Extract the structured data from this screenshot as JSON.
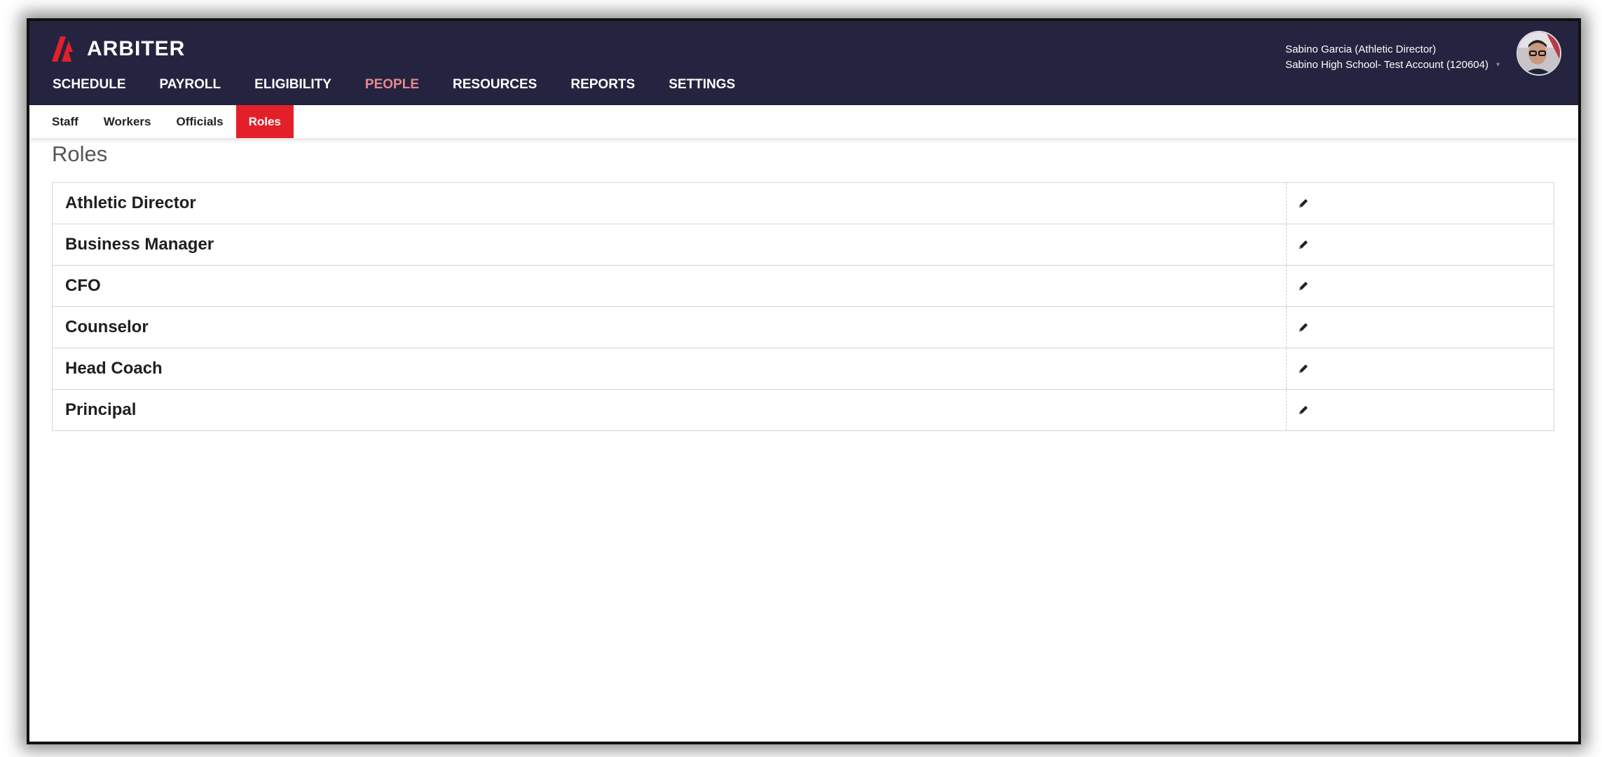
{
  "app": {
    "brand": "ARBITER"
  },
  "nav": {
    "items": [
      {
        "label": "SCHEDULE"
      },
      {
        "label": "PAYROLL"
      },
      {
        "label": "ELIGIBILITY"
      },
      {
        "label": "PEOPLE",
        "active": true
      },
      {
        "label": "RESOURCES"
      },
      {
        "label": "REPORTS"
      },
      {
        "label": "SETTINGS"
      }
    ]
  },
  "user": {
    "name": "Sabino Garcia (Athletic Director)",
    "account": "Sabino High School- Test Account (120604)"
  },
  "subnav": {
    "items": [
      {
        "label": "Staff"
      },
      {
        "label": "Workers"
      },
      {
        "label": "Officials"
      },
      {
        "label": "Roles",
        "active": true
      }
    ]
  },
  "page": {
    "title": "Roles"
  },
  "roles": [
    {
      "name": "Athletic Director",
      "action_icon": "pencil-icon"
    },
    {
      "name": "Business Manager",
      "action_icon": "pencil-icon"
    },
    {
      "name": "CFO",
      "action_icon": "pencil-icon"
    },
    {
      "name": "Counselor",
      "action_icon": "pencil-icon"
    },
    {
      "name": "Head Coach",
      "action_icon": "pencil-icon"
    },
    {
      "name": "Principal",
      "action_icon": "pencil-icon"
    }
  ],
  "colors": {
    "header_bg": "#252440",
    "accent_red": "#e3202a",
    "active_nav_text": "#e8898f"
  }
}
